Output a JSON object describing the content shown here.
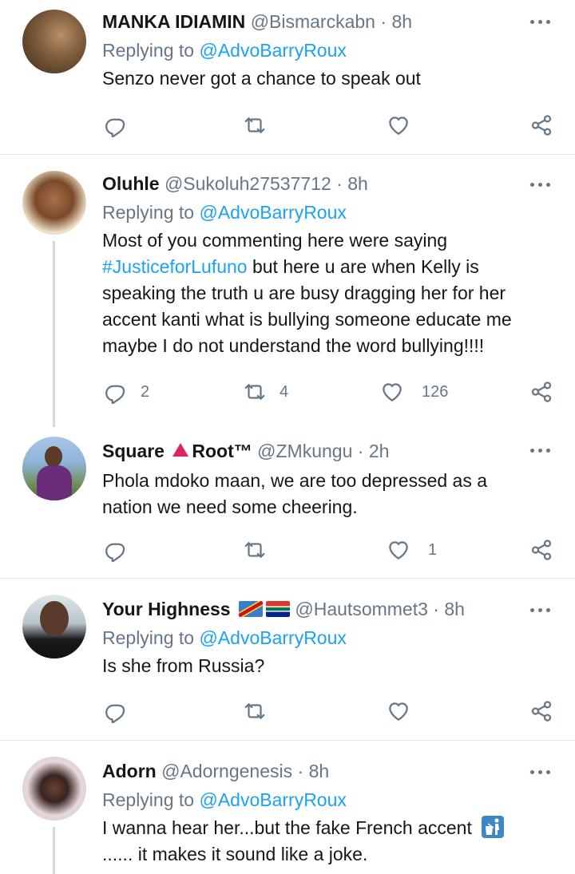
{
  "tweets": [
    {
      "name": "MANKA IDIAMIN",
      "handle": "@Bismarckabn",
      "dot": "·",
      "time": "8h",
      "replying_prefix": "Replying to",
      "replying_to": "@AdvoBarryRoux",
      "text": "Senzo never got a chance to speak out",
      "counts": {
        "reply": "",
        "retweet": "",
        "like": ""
      },
      "avatar_colors": [
        "#8a6a4a",
        "#3d2b1d"
      ]
    },
    {
      "name": "Oluhle",
      "handle": "@Sukoluh27537712",
      "dot": "·",
      "time": "8h",
      "replying_prefix": "Replying to",
      "replying_to": "@AdvoBarryRoux",
      "text_pre": "Most of you commenting here were saying",
      "hashtag": "#JusticeforLufuno",
      "text_post": " but here u are when Kelly is speaking the truth u are busy dragging her for her accent kanti what is bullying someone educate me maybe I do not understand the word bullying!!!!",
      "counts": {
        "reply": "2",
        "retweet": "4",
        "like": "126"
      },
      "avatar_colors": [
        "#e8c9a0",
        "#5a3520"
      ]
    },
    {
      "name_part1": "Square",
      "name_part2": "Root™",
      "handle": "@ZMkungu",
      "dot": "·",
      "time": "2h",
      "text": "Phola mdoko maan, we are too depressed as a nation we need some cheering.",
      "counts": {
        "reply": "",
        "retweet": "",
        "like": "1"
      },
      "avatar_colors": [
        "#8fb3d9",
        "#5a2d6b"
      ]
    },
    {
      "name": "Your Highness",
      "handle": "@Hautsommet3",
      "dot": "·",
      "time": "8h",
      "replying_prefix": "Replying to",
      "replying_to": "@AdvoBarryRoux",
      "text": "Is she from Russia?",
      "counts": {
        "reply": "",
        "retweet": "",
        "like": ""
      },
      "avatar_colors": [
        "#c9d4dc",
        "#1a1a1a"
      ]
    },
    {
      "name": "Adorn",
      "handle": "@Adorngenesis",
      "dot": "·",
      "time": "8h",
      "replying_prefix": "Replying to",
      "replying_to": "@AdvoBarryRoux",
      "text_line1": "I wanna hear her...but the fake French accent",
      "text_line2": "...... it makes it sound like a joke.",
      "avatar_colors": [
        "#d8c8cc",
        "#3a2420"
      ]
    }
  ],
  "colors": {
    "link": "#1da1f2",
    "secondary_text": "#657786",
    "divider": "#e1e8ed",
    "primary_text": "#14171a"
  }
}
